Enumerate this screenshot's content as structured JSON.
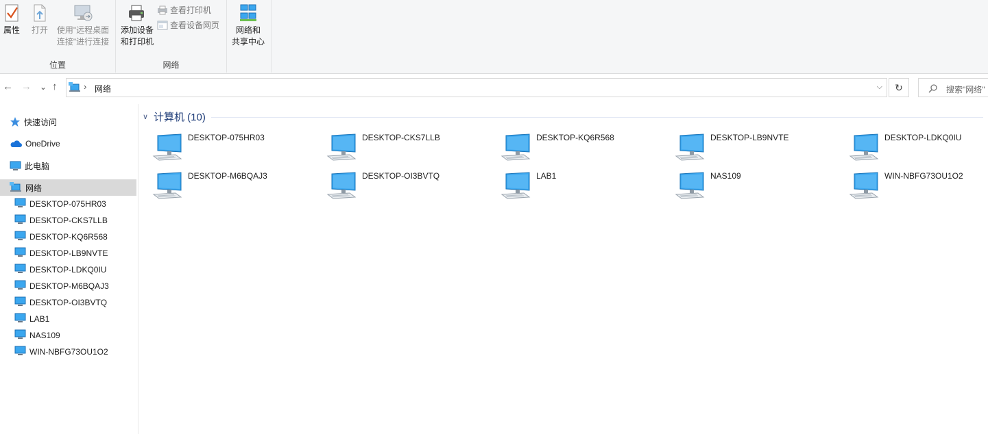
{
  "ribbon": {
    "location": {
      "label": "位置",
      "properties": {
        "label": "属性",
        "icon": "properties-check-icon"
      },
      "open": {
        "label": "打开",
        "icon": "open-icon"
      },
      "remote": {
        "line1": "使用\"远程桌面",
        "line2": "连接\"进行连接",
        "icon": "remote-desktop-icon"
      }
    },
    "network": {
      "label": "网络",
      "add_device": {
        "line1": "添加设备",
        "line2": "和打印机",
        "icon": "printer-icon"
      },
      "view_printers": {
        "label": "查看打印机",
        "icon": "printer-small-icon"
      },
      "view_device_page": {
        "label": "查看设备网页",
        "icon": "webpage-icon"
      }
    },
    "sharing": {
      "line1": "网络和",
      "line2": "共享中心",
      "icon": "network-sharing-icon"
    }
  },
  "navigation": {
    "back": "←",
    "forward": "→",
    "recent": "⌄",
    "up": "↑",
    "address_label": "网络",
    "address_sep": "›",
    "refresh": "↻",
    "search_placeholder": "搜索\"网络\""
  },
  "sidebar": {
    "items": [
      {
        "label": "快速访问",
        "icon": "star-icon"
      },
      {
        "label": "OneDrive",
        "icon": "cloud-icon"
      },
      {
        "label": "此电脑",
        "icon": "pc-icon"
      },
      {
        "label": "网络",
        "icon": "network-icon",
        "selected": true
      }
    ],
    "computers": [
      "DESKTOP-075HR03",
      "DESKTOP-CKS7LLB",
      "DESKTOP-KQ6R568",
      "DESKTOP-LB9NVTE",
      "DESKTOP-LDKQ0IU",
      "DESKTOP-M6BQAJ3",
      "DESKTOP-OI3BVTQ",
      "LAB1",
      "NAS109",
      "WIN-NBFG73OU1O2"
    ]
  },
  "main": {
    "group_title": "计算机 (10)",
    "items": [
      "DESKTOP-075HR03",
      "DESKTOP-CKS7LLB",
      "DESKTOP-KQ6R568",
      "DESKTOP-LB9NVTE",
      "DESKTOP-LDKQ0IU",
      "DESKTOP-M6BQAJ3",
      "DESKTOP-OI3BVTQ",
      "LAB1",
      "NAS109",
      "WIN-NBFG73OU1O2"
    ]
  },
  "colors": {
    "accent": "#1e3c78",
    "selected_bg": "#d9d9d9",
    "monitor_blue": "#3ba7ef"
  }
}
